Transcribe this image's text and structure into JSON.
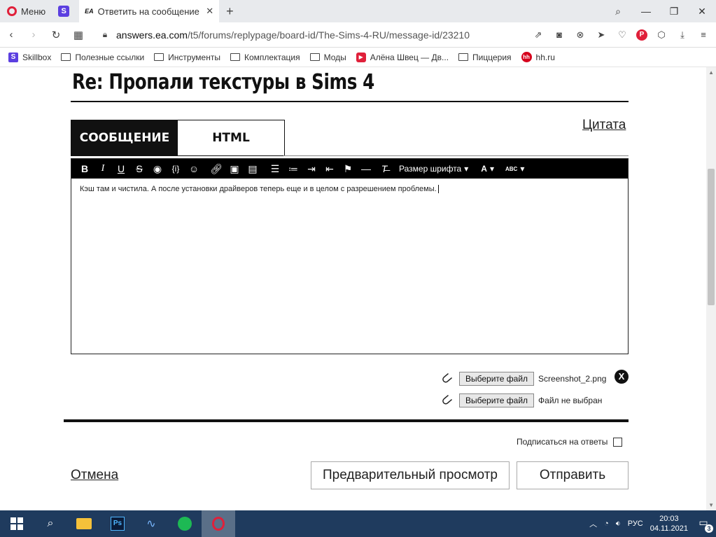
{
  "browser": {
    "menu_label": "Меню",
    "active_tab_title": "Ответить на сообщение -",
    "tab_brand": "EA",
    "url_host": "answers.ea.com",
    "url_path": "/t5/forums/replypage/board-id/The-Sims-4-RU/message-id/23210"
  },
  "bookmarks": [
    {
      "label": "Skillbox",
      "icon": "skillbox-icon"
    },
    {
      "label": "Полезные ссылки",
      "icon": "folder-icon"
    },
    {
      "label": "Инструменты",
      "icon": "folder-icon"
    },
    {
      "label": "Комплектация",
      "icon": "folder-icon"
    },
    {
      "label": "Моды",
      "icon": "folder-icon"
    },
    {
      "label": "Алёна Швец — Дв...",
      "icon": "youtube-icon"
    },
    {
      "label": "Пиццерия",
      "icon": "folder-icon"
    },
    {
      "label": "hh.ru",
      "icon": "hh-icon"
    }
  ],
  "page": {
    "title": "Re: Пропали текстуры в Sims 4",
    "tab_message": "СООБЩЕНИЕ",
    "tab_html": "HTML",
    "quote_link": "Цитата"
  },
  "editor": {
    "font_size_label": "Размер шрифта",
    "font_color_label": "A",
    "spell_label": "ABC",
    "body_text": "Кэш там и чистила. А после установки драйверов теперь еще и в целом с разрешением проблемы."
  },
  "attachments": [
    {
      "button": "Выберите файл",
      "status": "Screenshot_2.png"
    },
    {
      "button": "Выберите файл",
      "status": "Файл не выбран"
    }
  ],
  "remove_label": "X",
  "subscribe_label": "Подписаться на ответы",
  "actions": {
    "cancel": "Отмена",
    "preview": "Предварительный просмотр",
    "submit": "Отправить"
  },
  "taskbar": {
    "lang": "РУС",
    "time": "20:03",
    "date": "04.11.2021",
    "notifications": "3"
  },
  "colors": {
    "accent_black": "#111111",
    "opera_red": "#e0203a",
    "taskbar_bg": "#1f3b5e"
  }
}
